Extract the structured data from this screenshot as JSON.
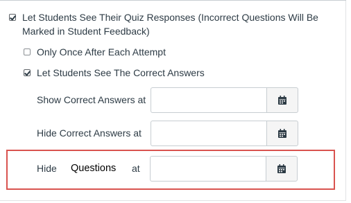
{
  "options": {
    "see_responses": {
      "label_line1": "Let Students See Their Quiz Responses (Incorrect Questions Will Be",
      "label_line2": "Marked in Student Feedback)",
      "checked": true
    },
    "only_once": {
      "label": "Only Once After Each Attempt",
      "checked": false
    },
    "see_correct": {
      "label": "Let Students See The Correct Answers",
      "checked": true
    }
  },
  "fields": {
    "show_correct": {
      "label": "Show Correct Answers at",
      "value": ""
    },
    "hide_correct": {
      "label": "Hide Correct Answers at",
      "value": ""
    },
    "hide_questions": {
      "label_hide": "Hide",
      "label_questions": "Questions",
      "label_at": "at",
      "value": ""
    }
  },
  "icons": {
    "calendar": "calendar-icon"
  },
  "colors": {
    "highlight": "#d9534f",
    "text": "#2d3b45"
  }
}
